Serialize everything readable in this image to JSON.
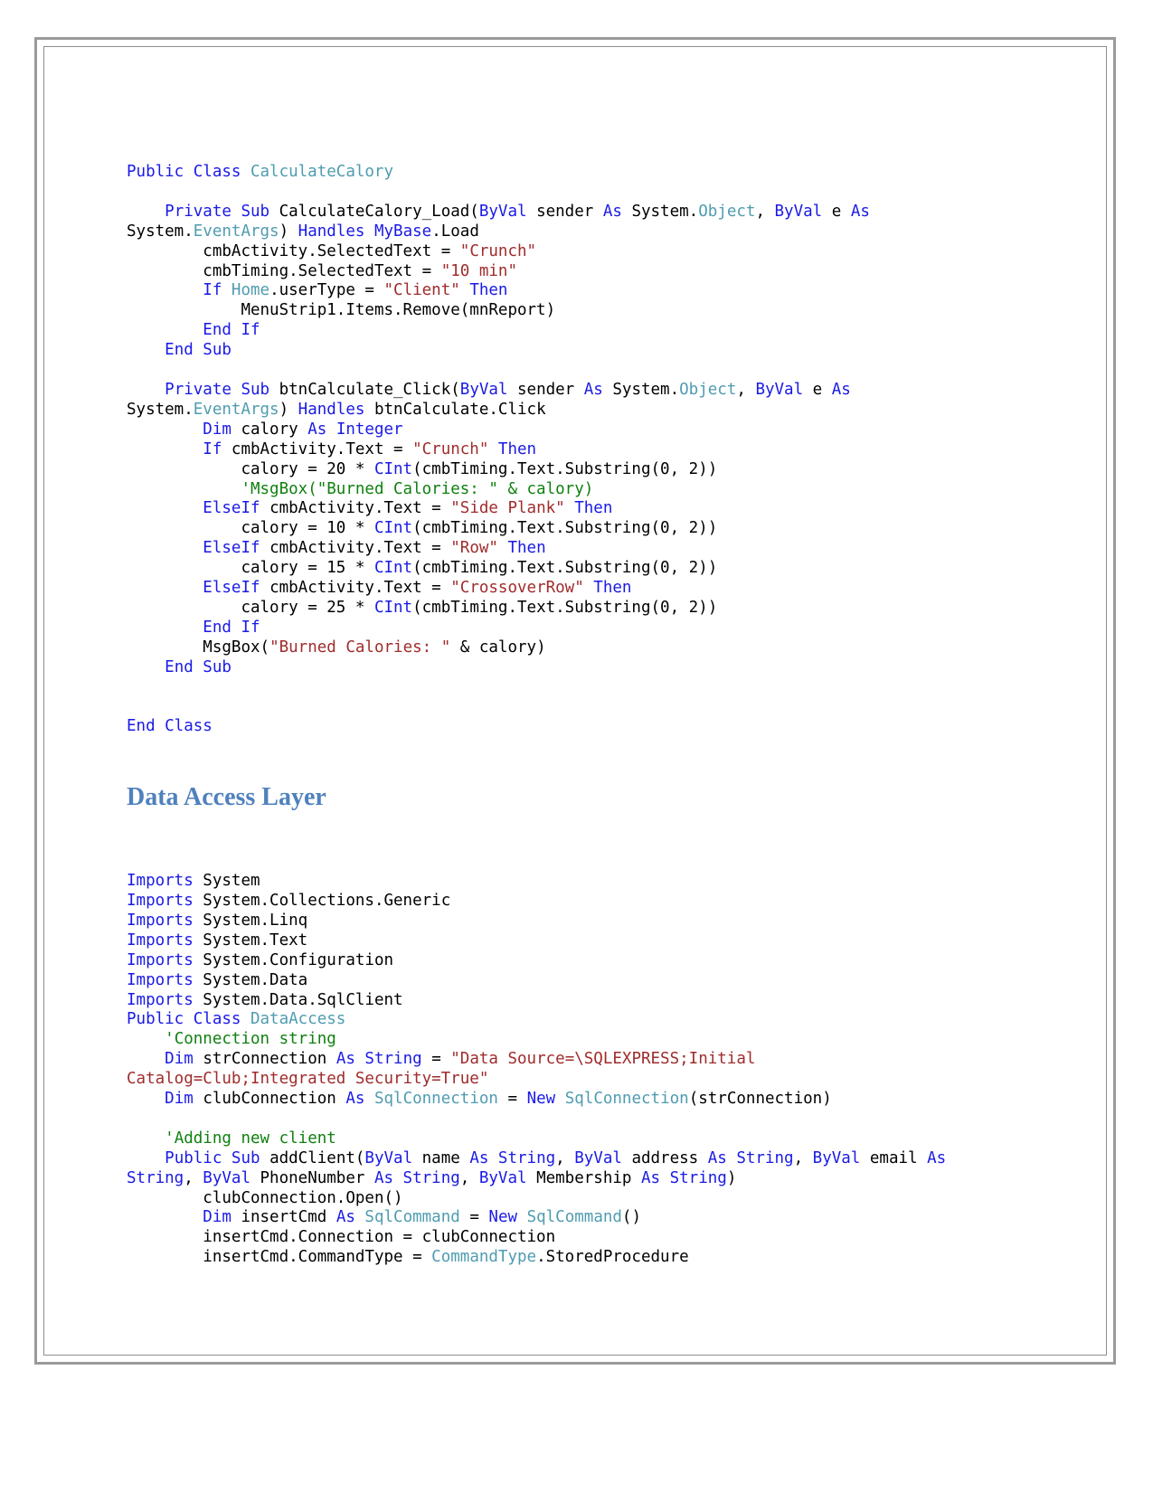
{
  "document": {
    "type": "vb-net-source-listing",
    "heading": "Data Access Layer",
    "heading_color": "#4F81BD",
    "syntax_colors": {
      "keyword": "#1A1AE6",
      "type": "#4F9CB0",
      "string": "#A02C2C",
      "comment": "#108010",
      "plain": "#000000"
    }
  },
  "code_block_1": {
    "lines": [
      [
        {
          "t": "Public Class ",
          "c": "kw"
        },
        {
          "t": "CalculateCalory",
          "c": "typ"
        }
      ],
      [],
      [
        {
          "t": "    ",
          "c": "pl"
        },
        {
          "t": "Private Sub ",
          "c": "kw"
        },
        {
          "t": "CalculateCalory_Load(",
          "c": "pl"
        },
        {
          "t": "ByVal ",
          "c": "kw"
        },
        {
          "t": "sender ",
          "c": "pl"
        },
        {
          "t": "As ",
          "c": "kw"
        },
        {
          "t": "System.",
          "c": "pl"
        },
        {
          "t": "Object",
          "c": "typ"
        },
        {
          "t": ", ",
          "c": "pl"
        },
        {
          "t": "ByVal ",
          "c": "kw"
        },
        {
          "t": "e ",
          "c": "pl"
        },
        {
          "t": "As ",
          "c": "kw"
        },
        {
          "t": "System.",
          "c": "pl"
        },
        {
          "t": "EventArgs",
          "c": "typ"
        },
        {
          "t": ") ",
          "c": "pl"
        },
        {
          "t": "Handles MyBase",
          "c": "kw"
        },
        {
          "t": ".Load",
          "c": "pl"
        }
      ],
      [
        {
          "t": "        cmbActivity.SelectedText = ",
          "c": "pl"
        },
        {
          "t": "\"Crunch\"",
          "c": "str"
        }
      ],
      [
        {
          "t": "        cmbTiming.SelectedText = ",
          "c": "pl"
        },
        {
          "t": "\"10 min\"",
          "c": "str"
        }
      ],
      [
        {
          "t": "        ",
          "c": "pl"
        },
        {
          "t": "If ",
          "c": "kw"
        },
        {
          "t": "Home",
          "c": "typ"
        },
        {
          "t": ".userType = ",
          "c": "pl"
        },
        {
          "t": "\"Client\" ",
          "c": "str"
        },
        {
          "t": "Then",
          "c": "kw"
        }
      ],
      [
        {
          "t": "            MenuStrip1.Items.Remove(mnReport)",
          "c": "pl"
        }
      ],
      [
        {
          "t": "        ",
          "c": "pl"
        },
        {
          "t": "End If",
          "c": "kw"
        }
      ],
      [
        {
          "t": "    ",
          "c": "pl"
        },
        {
          "t": "End Sub",
          "c": "kw"
        }
      ],
      [],
      [
        {
          "t": "    ",
          "c": "pl"
        },
        {
          "t": "Private Sub ",
          "c": "kw"
        },
        {
          "t": "btnCalculate_Click(",
          "c": "pl"
        },
        {
          "t": "ByVal ",
          "c": "kw"
        },
        {
          "t": "sender ",
          "c": "pl"
        },
        {
          "t": "As ",
          "c": "kw"
        },
        {
          "t": "System.",
          "c": "pl"
        },
        {
          "t": "Object",
          "c": "typ"
        },
        {
          "t": ", ",
          "c": "pl"
        },
        {
          "t": "ByVal ",
          "c": "kw"
        },
        {
          "t": "e ",
          "c": "pl"
        },
        {
          "t": "As ",
          "c": "kw"
        },
        {
          "t": "System.",
          "c": "pl"
        },
        {
          "t": "EventArgs",
          "c": "typ"
        },
        {
          "t": ") ",
          "c": "pl"
        },
        {
          "t": "Handles ",
          "c": "kw"
        },
        {
          "t": "btnCalculate.Click",
          "c": "pl"
        }
      ],
      [
        {
          "t": "        ",
          "c": "pl"
        },
        {
          "t": "Dim ",
          "c": "kw"
        },
        {
          "t": "calory ",
          "c": "pl"
        },
        {
          "t": "As Integer",
          "c": "kw"
        }
      ],
      [
        {
          "t": "        ",
          "c": "pl"
        },
        {
          "t": "If ",
          "c": "kw"
        },
        {
          "t": "cmbActivity.Text = ",
          "c": "pl"
        },
        {
          "t": "\"Crunch\" ",
          "c": "str"
        },
        {
          "t": "Then",
          "c": "kw"
        }
      ],
      [
        {
          "t": "            calory = 20 * ",
          "c": "pl"
        },
        {
          "t": "CInt",
          "c": "kw"
        },
        {
          "t": "(cmbTiming.Text.Substring(0, 2))",
          "c": "pl"
        }
      ],
      [
        {
          "t": "            ",
          "c": "pl"
        },
        {
          "t": "'MsgBox(\"Burned Calories: \" & calory)",
          "c": "cmt"
        }
      ],
      [
        {
          "t": "        ",
          "c": "pl"
        },
        {
          "t": "ElseIf ",
          "c": "kw"
        },
        {
          "t": "cmbActivity.Text = ",
          "c": "pl"
        },
        {
          "t": "\"Side Plank\" ",
          "c": "str"
        },
        {
          "t": "Then",
          "c": "kw"
        }
      ],
      [
        {
          "t": "            calory = 10 * ",
          "c": "pl"
        },
        {
          "t": "CInt",
          "c": "kw"
        },
        {
          "t": "(cmbTiming.Text.Substring(0, 2))",
          "c": "pl"
        }
      ],
      [
        {
          "t": "        ",
          "c": "pl"
        },
        {
          "t": "ElseIf ",
          "c": "kw"
        },
        {
          "t": "cmbActivity.Text = ",
          "c": "pl"
        },
        {
          "t": "\"Row\" ",
          "c": "str"
        },
        {
          "t": "Then",
          "c": "kw"
        }
      ],
      [
        {
          "t": "            calory = 15 * ",
          "c": "pl"
        },
        {
          "t": "CInt",
          "c": "kw"
        },
        {
          "t": "(cmbTiming.Text.Substring(0, 2))",
          "c": "pl"
        }
      ],
      [
        {
          "t": "        ",
          "c": "pl"
        },
        {
          "t": "ElseIf ",
          "c": "kw"
        },
        {
          "t": "cmbActivity.Text = ",
          "c": "pl"
        },
        {
          "t": "\"CrossoverRow\" ",
          "c": "str"
        },
        {
          "t": "Then",
          "c": "kw"
        }
      ],
      [
        {
          "t": "            calory = 25 * ",
          "c": "pl"
        },
        {
          "t": "CInt",
          "c": "kw"
        },
        {
          "t": "(cmbTiming.Text.Substring(0, 2))",
          "c": "pl"
        }
      ],
      [
        {
          "t": "        ",
          "c": "pl"
        },
        {
          "t": "End If",
          "c": "kw"
        }
      ],
      [
        {
          "t": "        MsgBox(",
          "c": "pl"
        },
        {
          "t": "\"Burned Calories: \"",
          "c": "str"
        },
        {
          "t": " & calory)",
          "c": "pl"
        }
      ],
      [
        {
          "t": "    ",
          "c": "pl"
        },
        {
          "t": "End Sub",
          "c": "kw"
        }
      ],
      [],
      [],
      [
        {
          "t": "End Class",
          "c": "kw"
        }
      ]
    ]
  },
  "code_block_2": {
    "lines": [
      [
        {
          "t": "Imports ",
          "c": "kw"
        },
        {
          "t": "System",
          "c": "pl"
        }
      ],
      [
        {
          "t": "Imports ",
          "c": "kw"
        },
        {
          "t": "System.Collections.Generic",
          "c": "pl"
        }
      ],
      [
        {
          "t": "Imports ",
          "c": "kw"
        },
        {
          "t": "System.Linq",
          "c": "pl"
        }
      ],
      [
        {
          "t": "Imports ",
          "c": "kw"
        },
        {
          "t": "System.Text",
          "c": "pl"
        }
      ],
      [
        {
          "t": "Imports ",
          "c": "kw"
        },
        {
          "t": "System.Configuration",
          "c": "pl"
        }
      ],
      [
        {
          "t": "Imports ",
          "c": "kw"
        },
        {
          "t": "System.Data",
          "c": "pl"
        }
      ],
      [
        {
          "t": "Imports ",
          "c": "kw"
        },
        {
          "t": "System.Data.SqlClient",
          "c": "pl"
        }
      ],
      [
        {
          "t": "Public Class ",
          "c": "kw"
        },
        {
          "t": "DataAccess",
          "c": "typ"
        }
      ],
      [
        {
          "t": "    ",
          "c": "pl"
        },
        {
          "t": "'Connection string",
          "c": "cmt"
        }
      ],
      [
        {
          "t": "    ",
          "c": "pl"
        },
        {
          "t": "Dim ",
          "c": "kw"
        },
        {
          "t": "strConnection ",
          "c": "pl"
        },
        {
          "t": "As String ",
          "c": "kw"
        },
        {
          "t": "= ",
          "c": "pl"
        },
        {
          "t": "\"Data Source=\\SQLEXPRESS;Initial Catalog=Club;Integrated Security=True\"",
          "c": "str"
        }
      ],
      [
        {
          "t": "    ",
          "c": "pl"
        },
        {
          "t": "Dim ",
          "c": "kw"
        },
        {
          "t": "clubConnection ",
          "c": "pl"
        },
        {
          "t": "As ",
          "c": "kw"
        },
        {
          "t": "SqlConnection ",
          "c": "typ"
        },
        {
          "t": "= ",
          "c": "pl"
        },
        {
          "t": "New ",
          "c": "kw"
        },
        {
          "t": "SqlConnection",
          "c": "typ"
        },
        {
          "t": "(strConnection)",
          "c": "pl"
        }
      ],
      [],
      [
        {
          "t": "    ",
          "c": "pl"
        },
        {
          "t": "'Adding new client",
          "c": "cmt"
        }
      ],
      [
        {
          "t": "    ",
          "c": "pl"
        },
        {
          "t": "Public Sub ",
          "c": "kw"
        },
        {
          "t": "addClient(",
          "c": "pl"
        },
        {
          "t": "ByVal ",
          "c": "kw"
        },
        {
          "t": "name ",
          "c": "pl"
        },
        {
          "t": "As String",
          "c": "kw"
        },
        {
          "t": ", ",
          "c": "pl"
        },
        {
          "t": "ByVal ",
          "c": "kw"
        },
        {
          "t": "address ",
          "c": "pl"
        },
        {
          "t": "As String",
          "c": "kw"
        },
        {
          "t": ", ",
          "c": "pl"
        },
        {
          "t": "ByVal ",
          "c": "kw"
        },
        {
          "t": "email ",
          "c": "pl"
        },
        {
          "t": "As String",
          "c": "kw"
        },
        {
          "t": ", ",
          "c": "pl"
        },
        {
          "t": "ByVal ",
          "c": "kw"
        },
        {
          "t": "PhoneNumber ",
          "c": "pl"
        },
        {
          "t": "As String",
          "c": "kw"
        },
        {
          "t": ", ",
          "c": "pl"
        },
        {
          "t": "ByVal ",
          "c": "kw"
        },
        {
          "t": "Membership ",
          "c": "pl"
        },
        {
          "t": "As String",
          "c": "kw"
        },
        {
          "t": ")",
          "c": "pl"
        }
      ],
      [
        {
          "t": "        clubConnection.Open()",
          "c": "pl"
        }
      ],
      [
        {
          "t": "        ",
          "c": "pl"
        },
        {
          "t": "Dim ",
          "c": "kw"
        },
        {
          "t": "insertCmd ",
          "c": "pl"
        },
        {
          "t": "As ",
          "c": "kw"
        },
        {
          "t": "SqlCommand ",
          "c": "typ"
        },
        {
          "t": "= ",
          "c": "pl"
        },
        {
          "t": "New ",
          "c": "kw"
        },
        {
          "t": "SqlCommand",
          "c": "typ"
        },
        {
          "t": "()",
          "c": "pl"
        }
      ],
      [
        {
          "t": "        insertCmd.Connection = clubConnection",
          "c": "pl"
        }
      ],
      [
        {
          "t": "        insertCmd.CommandType = ",
          "c": "pl"
        },
        {
          "t": "CommandType",
          "c": "typ"
        },
        {
          "t": ".StoredProcedure",
          "c": "pl"
        }
      ]
    ]
  }
}
